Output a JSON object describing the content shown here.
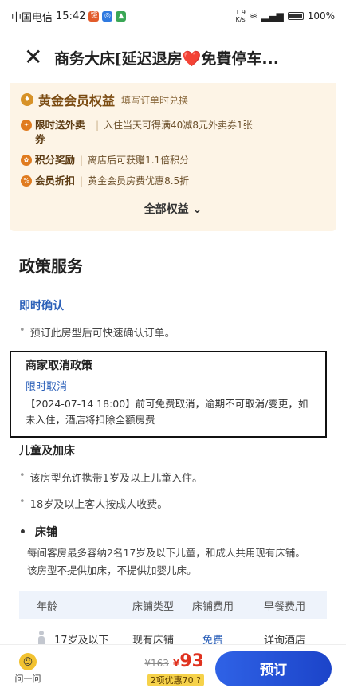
{
  "status_bar": {
    "carrier": "中国电信",
    "time": "15:42",
    "net_speed": "1.9\nK/s",
    "battery": "100%"
  },
  "header": {
    "title": "商务大床[延迟退房❤️免費停车..."
  },
  "member": {
    "title": "黄金会员权益",
    "subtitle": "填写订单时兑换",
    "benefits": [
      {
        "label": "限时送外卖券",
        "desc": "入住当天可得满40减8元外卖券1张",
        "icon": "gift-icon"
      },
      {
        "label": "积分奖励",
        "desc": "离店后可获赠1.1倍积分",
        "icon": "points-icon"
      },
      {
        "label": "会员折扣",
        "desc": "黄金会员房费优惠8.5折",
        "icon": "discount-icon"
      }
    ],
    "all_label": "全部权益 ⌄"
  },
  "policy": {
    "title": "政策服务",
    "instant_title": "即时确认",
    "instant_desc": "预订此房型后可快速确认订单。",
    "cancel_title": "商家取消政策",
    "cancel_sub": "限时取消",
    "cancel_desc": "【2024-07-14 18:00】前可免费取消，逾期不可取消/变更，如未入住，酒店将扣除全额房费",
    "kids_title": "儿童及加床",
    "kids_items": [
      "该房型允许携带1岁及以上儿童入住。",
      "18岁及以上客人按成人收费。"
    ],
    "bed_title": "床铺",
    "bed_desc": [
      "每间客房最多容纳2名17岁及以下儿童，和成人共用现有床铺。",
      "该房型不提供加床，不提供加婴儿床。"
    ]
  },
  "fee_table": {
    "headers": [
      "年龄",
      "床铺类型",
      "床铺费用",
      "早餐费用"
    ],
    "rows": [
      {
        "age": "17岁及以下",
        "bed_type": "现有床铺",
        "bed_fee": "免费",
        "breakfast_fee": "详询酒店"
      }
    ]
  },
  "bottom": {
    "ask_label": "问一问",
    "orig_price": "¥163",
    "price_symbol": "¥",
    "price": "93",
    "discount": "2项优惠70 ?",
    "book_label": "预订"
  },
  "colors": {
    "accent": "#2a5fb8",
    "price": "#e0321f",
    "member_bg": "#fdf4e6"
  }
}
